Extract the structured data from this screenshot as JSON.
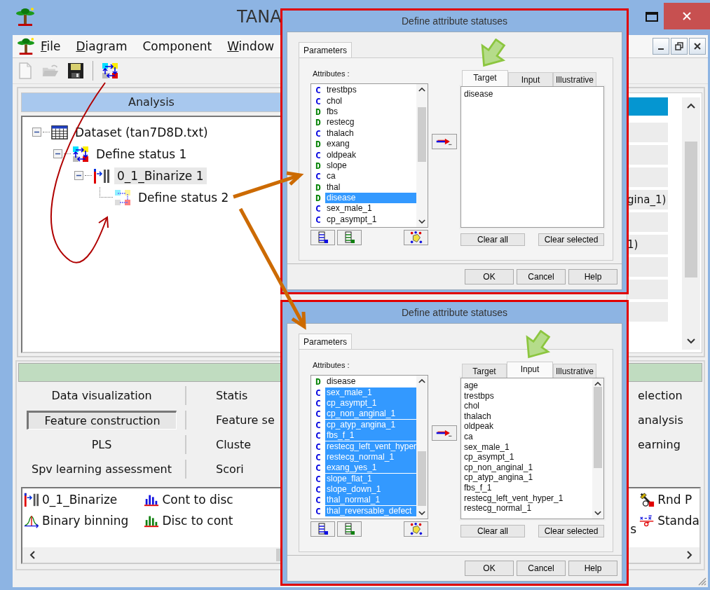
{
  "window": {
    "title": "TANA"
  },
  "menu": [
    {
      "label": "File",
      "mnemonic": true
    },
    {
      "label": "Diagram",
      "mnemonic": true
    },
    {
      "label": "Component",
      "mnemonic": false
    },
    {
      "label": "Window",
      "mnemonic": true
    }
  ],
  "toolbar": [
    {
      "kind": "new",
      "disabled": true
    },
    {
      "kind": "open",
      "disabled": true
    },
    {
      "kind": "save",
      "disabled": false
    },
    {
      "kind": "separator"
    },
    {
      "kind": "status",
      "disabled": false
    }
  ],
  "analysis": {
    "title": "Analysis",
    "tree": [
      {
        "label": "Dataset (tan7D8D.txt)",
        "kind": "table",
        "selected": false,
        "expanded": true,
        "children": [
          {
            "label": "Define status 1",
            "kind": "status",
            "selected": false,
            "expanded": true,
            "children": [
              {
                "label": "0_1_Binarize 1",
                "kind": "binarize",
                "selected": true,
                "expanded": true,
                "children": [
                  {
                    "label": "Define status 2",
                    "kind": "status-faded",
                    "selected": false
                  }
                ]
              }
            ]
          }
        ]
      }
    ]
  },
  "results": {
    "rows": [
      {
        "selected": true
      },
      {
        "selected": false
      },
      {
        "selected": false
      },
      {
        "selected": false
      },
      {
        "text": "gina_1)",
        "selected": false
      },
      {
        "selected": false
      },
      {
        "text": "1)",
        "selected": false
      },
      {
        "selected": false
      },
      {
        "selected": false
      },
      {
        "selected": false
      }
    ]
  },
  "tab_rows": [
    {
      "cells": [
        {
          "label": "Data visualization",
          "selected": false
        },
        {
          "label": "Statis",
          "selected": false
        },
        {
          "label": "election",
          "selected": false
        }
      ]
    },
    {
      "cells": [
        {
          "label": "Feature construction",
          "selected": true
        },
        {
          "label": "Feature se",
          "selected": false
        },
        {
          "label": "analysis",
          "selected": false
        }
      ]
    },
    {
      "cells": [
        {
          "label": "PLS",
          "selected": false
        },
        {
          "label": "Cluste",
          "selected": false
        },
        {
          "label": "earning",
          "selected": false
        }
      ]
    },
    {
      "cells": [
        {
          "label": "Spv learning assessment",
          "selected": false
        },
        {
          "label": "Scori",
          "selected": false
        }
      ]
    }
  ],
  "components": {
    "left_columns": [
      {
        "items": [
          {
            "label": "0_1_Binarize",
            "kind": "binarize"
          },
          {
            "label": "Binary binning",
            "kind": "binning"
          }
        ]
      },
      {
        "items": [
          {
            "label": "Cont to disc",
            "kind": "bars-c"
          },
          {
            "label": "Disc to cont",
            "kind": "bars-d"
          }
        ]
      }
    ],
    "right_columns": [
      {
        "items": [
          {
            "label": "s"
          }
        ]
      },
      {
        "items": [
          {
            "label": "Rnd P",
            "kind": "tool"
          },
          {
            "label": "Standa",
            "kind": "formula"
          }
        ]
      }
    ]
  },
  "dialogs": [
    {
      "title": "Define attribute statuses",
      "tab": "Parameters",
      "attributes_label": "Attributes :",
      "attributes": [
        {
          "type": "C",
          "name": "trestbps",
          "selected": false
        },
        {
          "type": "C",
          "name": "chol",
          "selected": false
        },
        {
          "type": "D",
          "name": "fbs",
          "selected": false
        },
        {
          "type": "D",
          "name": "restecg",
          "selected": false
        },
        {
          "type": "C",
          "name": "thalach",
          "selected": false
        },
        {
          "type": "D",
          "name": "exang",
          "selected": false
        },
        {
          "type": "C",
          "name": "oldpeak",
          "selected": false
        },
        {
          "type": "D",
          "name": "slope",
          "selected": false
        },
        {
          "type": "C",
          "name": "ca",
          "selected": false
        },
        {
          "type": "D",
          "name": "thal",
          "selected": false
        },
        {
          "type": "D",
          "name": "disease",
          "selected": true
        },
        {
          "type": "C",
          "name": "sex_male_1",
          "selected": false
        },
        {
          "type": "C",
          "name": "cp_asympt_1",
          "selected": false
        }
      ],
      "status_tabs": [
        {
          "label": "Target",
          "selected": true
        },
        {
          "label": "Input",
          "selected": false
        },
        {
          "label": "Illustrative",
          "selected": false
        }
      ],
      "status_items": [
        "disease"
      ],
      "clear_buttons": [
        "Clear all",
        "Clear selected"
      ],
      "footer_buttons": [
        "OK",
        "Cancel",
        "Help"
      ]
    },
    {
      "title": "Define attribute statuses",
      "tab": "Parameters",
      "attributes_label": "Attributes :",
      "attributes": [
        {
          "type": "D",
          "name": "disease",
          "selected": false
        },
        {
          "type": "C",
          "name": "sex_male_1",
          "selected": true
        },
        {
          "type": "C",
          "name": "cp_asympt_1",
          "selected": true
        },
        {
          "type": "C",
          "name": "cp_non_anginal_1",
          "selected": true
        },
        {
          "type": "C",
          "name": "cp_atyp_angina_1",
          "selected": true
        },
        {
          "type": "C",
          "name": "fbs_f_1",
          "selected": true
        },
        {
          "type": "C",
          "name": "restecg_left_vent_hyper",
          "selected": true
        },
        {
          "type": "C",
          "name": "restecg_normal_1",
          "selected": true
        },
        {
          "type": "C",
          "name": "exang_yes_1",
          "selected": true
        },
        {
          "type": "C",
          "name": "slope_flat_1",
          "selected": true
        },
        {
          "type": "C",
          "name": "slope_down_1",
          "selected": true
        },
        {
          "type": "C",
          "name": "thal_normal_1",
          "selected": true
        },
        {
          "type": "C",
          "name": "thal_reversable_defect",
          "selected": true
        }
      ],
      "status_tabs": [
        {
          "label": "Target",
          "selected": false
        },
        {
          "label": "Input",
          "selected": true
        },
        {
          "label": "Illustrative",
          "selected": false
        }
      ],
      "status_items": [
        "age",
        "trestbps",
        "chol",
        "thalach",
        "oldpeak",
        "ca",
        "sex_male_1",
        "cp_asympt_1",
        "cp_non_anginal_1",
        "cp_atyp_angina_1",
        "fbs_f_1",
        "restecg_left_vent_hyper_1",
        "restecg_normal_1"
      ],
      "clear_buttons": [
        "Clear all",
        "Clear selected"
      ],
      "footer_buttons": [
        "OK",
        "Cancel",
        "Help"
      ]
    }
  ]
}
